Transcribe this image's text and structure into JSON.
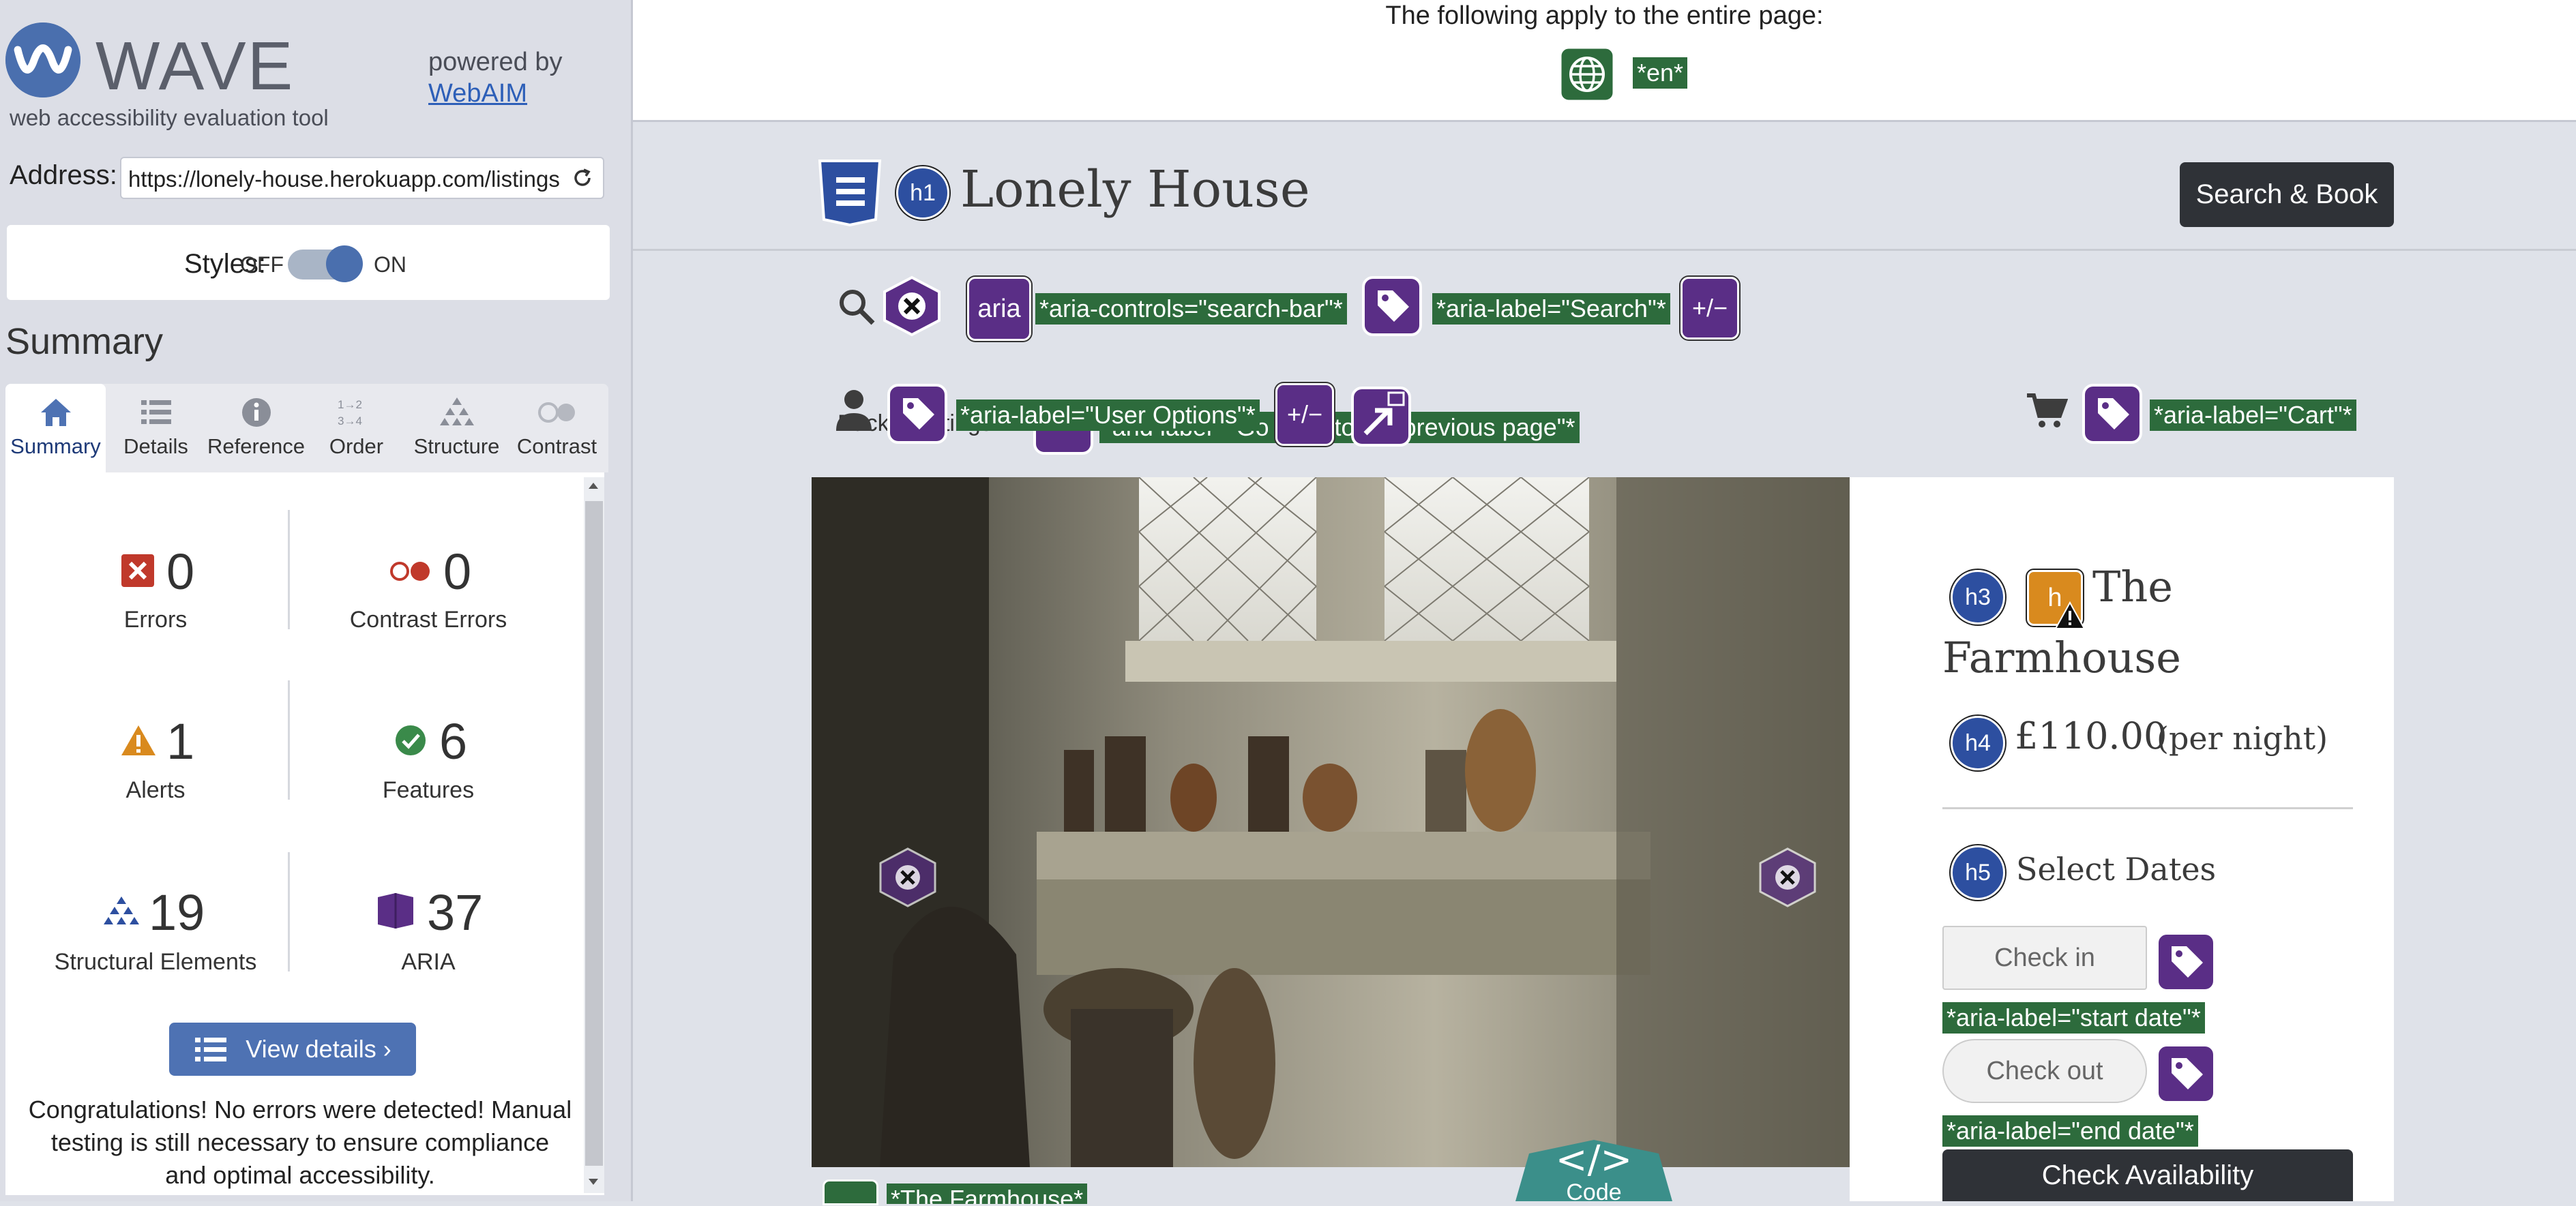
{
  "sidebar": {
    "title": "WAVE",
    "subtitle": "web accessibility evaluation tool",
    "powered_by": "powered by",
    "webaim_link": "WebAIM",
    "address_label": "Address:",
    "address_value": "https://lonely-house.herokuapp.com/listings",
    "styles_label": "Styles:",
    "styles_off": "OFF",
    "styles_on": "ON",
    "summary_heading": "Summary",
    "tabs": [
      {
        "label": "Summary",
        "icon": "home-icon"
      },
      {
        "label": "Details",
        "icon": "list-icon"
      },
      {
        "label": "Reference",
        "icon": "info-icon"
      },
      {
        "label": "Order",
        "icon": "order-icon"
      },
      {
        "label": "Structure",
        "icon": "structure-icon"
      },
      {
        "label": "Contrast",
        "icon": "contrast-icon"
      }
    ],
    "stats": {
      "errors": {
        "count": "0",
        "label": "Errors"
      },
      "contrast": {
        "count": "0",
        "label": "Contrast Errors"
      },
      "alerts": {
        "count": "1",
        "label": "Alerts"
      },
      "features": {
        "count": "6",
        "label": "Features"
      },
      "structural": {
        "count": "19",
        "label": "Structural Elements"
      },
      "aria": {
        "count": "37",
        "label": "ARIA"
      }
    },
    "view_details": "View details ›",
    "congrats": "Congratulations! No errors were detected! Manual testing is still necessary to ensure compliance and optimal accessibility."
  },
  "page": {
    "apply_text": "The following apply to the entire page:",
    "lang_tag": "*en*",
    "site_name": "Lonely House",
    "h1_badge": "h1",
    "search_book": "Search & Book",
    "aria_badge": "aria",
    "plus_minus": "+/−",
    "tags": {
      "aria_controls": "*aria-controls=\"search-bar\"*",
      "aria_search": "*aria-label=\"Search\"*",
      "user_options": "*aria-label=\"User Options\"*",
      "prev_page_fragment": "\"and label\" \"Go back to the previous page\"*",
      "cart": "*aria-label=\"Cart\"*",
      "start_date": "*aria-label=\"start date\"*",
      "end_date": "*aria-label=\"end date\"*",
      "farmhouse_alt": "*The Farmhouse*"
    },
    "back_text": "Back to listings",
    "card": {
      "h3": "h3",
      "h_alert": "h",
      "title_line1": "The",
      "title_line2": "Farmhouse",
      "h4": "h4",
      "price": "£110.00",
      "per_night": "(per night)",
      "h5": "h5",
      "select_dates": "Select Dates",
      "check_in": "Check in",
      "check_out": "Check out",
      "check_availability": "Check Availability"
    },
    "code_label": "Code"
  },
  "colors": {
    "wave_purple": "#5a2e86",
    "heading_blue": "#2d4fa0",
    "tag_green": "#2d6b3c",
    "error_red": "#c0392b",
    "alert_orange": "#d98a1e",
    "feature_green": "#3a8a4a"
  }
}
